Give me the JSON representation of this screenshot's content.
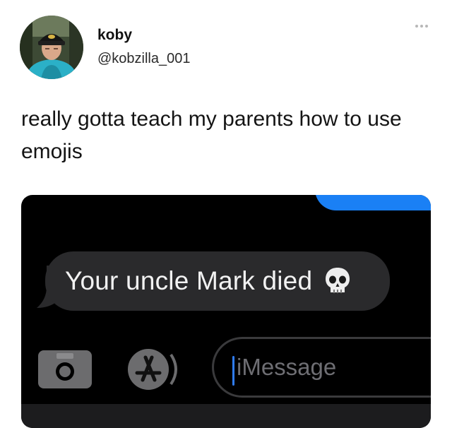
{
  "tweet": {
    "display_name": "koby",
    "handle": "@kobzilla_001",
    "text": "really gotta teach my parents how to use emojis",
    "more_icon": "more-dots-icon"
  },
  "screenshot": {
    "received_message": "Your uncle Mark died",
    "emoji": "skull-emoji",
    "input_placeholder": "iMessage",
    "icons": [
      "camera-icon",
      "app-store-icon"
    ],
    "colors": {
      "background": "#000000",
      "bubble": "#2a2a2c",
      "sent_bubble": "#1a80f5",
      "caret": "#2f7cf6",
      "placeholder": "#6e6e73"
    }
  }
}
